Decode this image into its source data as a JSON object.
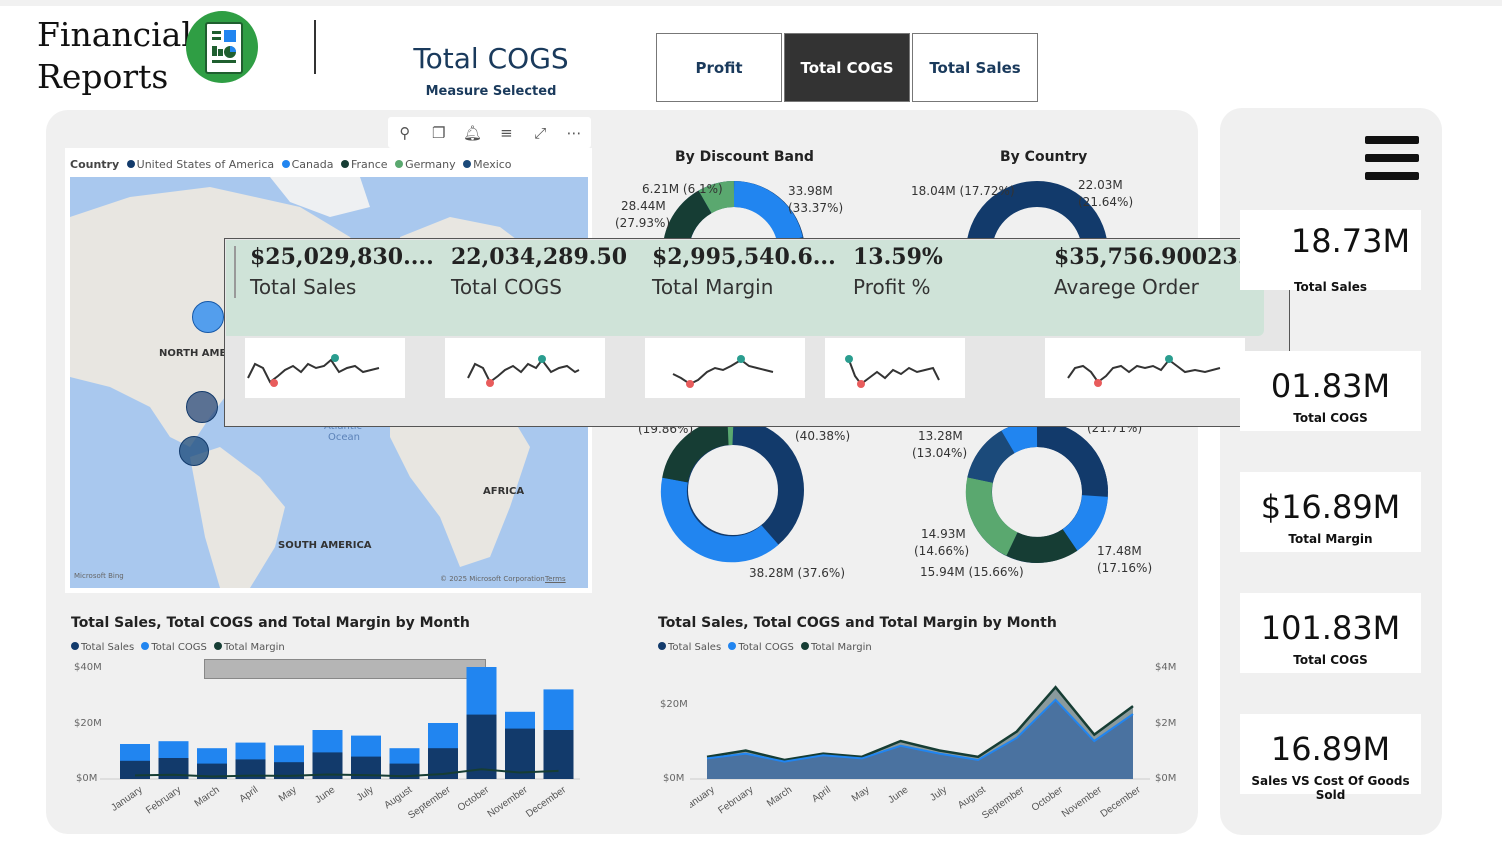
{
  "header": {
    "logo_line1": "Financial",
    "logo_line2": "Reports",
    "measure_title": "Total COGS",
    "measure_sub": "Measure Selected",
    "buttons": [
      {
        "label": "Profit",
        "active": false
      },
      {
        "label": "Total COGS",
        "active": true
      },
      {
        "label": "Total Sales",
        "active": false
      }
    ]
  },
  "map": {
    "legend_title": "Country",
    "legend": [
      {
        "name": "United States of America",
        "color": "#123a6b"
      },
      {
        "name": "Canada",
        "color": "#2185f0"
      },
      {
        "name": "France",
        "color": "#163d34"
      },
      {
        "name": "Germany",
        "color": "#5aa86f"
      },
      {
        "name": "Mexico",
        "color": "#1b4a7a"
      }
    ],
    "labels": {
      "north_america": "NORTH AMER",
      "atlantic": "Atlantic",
      "ocean": "Ocean",
      "africa": "AFRICA",
      "south_america": "SOUTH AMERICA",
      "bing": "Microsoft Bing",
      "copyright": "© 2025 Microsoft Corporation",
      "terms": "Terms"
    }
  },
  "donut_discount": {
    "title": "By Discount Band",
    "labels": {
      "a": "6.21M (6.1%)",
      "b": "28.44M",
      "b2": "(27.93%)",
      "c": "33.98M",
      "c2": "(33.37%)",
      "d": "(19.86%)",
      "e": "(40.38%)",
      "f": "38.28M (37.6%)"
    }
  },
  "donut_country": {
    "title": "By Country",
    "labels": {
      "a": "18.04M (17.72%)",
      "b": "22.03M",
      "b2": "(21.64%)",
      "c": "(21.71%)",
      "d": "13.28M",
      "d2": "(13.04%)",
      "e": "14.93M",
      "e2": "(14.66%)",
      "f": "15.94M (15.66%)",
      "g": "17.48M",
      "g2": "(17.16%)"
    }
  },
  "tooltip": {
    "cards": [
      {
        "value": "$25,029,830....",
        "label": "Total Sales"
      },
      {
        "value": "22,034,289.50",
        "label": "Total COGS"
      },
      {
        "value": "$2,995,540.6...",
        "label": "Total Margin"
      },
      {
        "value": "13.59%",
        "label": "Profit %"
      },
      {
        "value": "$35,756.90023...",
        "label": "Avarege Order"
      }
    ]
  },
  "kpis": [
    {
      "value": "18.73M",
      "label": "Total Sales"
    },
    {
      "value": "01.83M",
      "label": "Total COGS"
    },
    {
      "value": "$16.89M",
      "label": "Total Margin"
    },
    {
      "value": "101.83M",
      "label": "Total COGS"
    },
    {
      "value": "16.89M",
      "label": "Sales VS Cost Of Goods Sold"
    }
  ],
  "colors": {
    "sales": "#2185f0",
    "cogs": "#123a6b",
    "margin": "#163d34",
    "accent": "#5aa86f"
  },
  "chart_data": [
    {
      "type": "bar",
      "title": "Total Sales, Total COGS and Total Margin by Month",
      "legend": [
        "Total Sales",
        "Total COGS",
        "Total Margin"
      ],
      "categories": [
        "January",
        "February",
        "March",
        "April",
        "May",
        "June",
        "July",
        "August",
        "September",
        "October",
        "November",
        "December"
      ],
      "series": [
        {
          "name": "Total COGS",
          "values": [
            6.5,
            7.5,
            5.5,
            7,
            6,
            9.5,
            8,
            5.5,
            11,
            23,
            18,
            17.5
          ]
        },
        {
          "name": "Total Sales",
          "values": [
            12.5,
            13.5,
            11,
            13,
            12,
            17.5,
            15.5,
            11,
            20,
            40,
            24,
            32
          ]
        },
        {
          "name": "Total Margin",
          "values": [
            1.3,
            1.5,
            0.9,
            1.2,
            1.1,
            1.6,
            1.4,
            1.0,
            1.8,
            3.5,
            2.3,
            2.9
          ]
        }
      ],
      "yticks": [
        "$40M",
        "$20M",
        "$0M"
      ],
      "ylim": [
        0,
        40
      ]
    },
    {
      "type": "area",
      "title": "Total Sales, Total COGS and Total Margin by Month",
      "legend": [
        "Total Sales",
        "Total COGS",
        "Total Margin"
      ],
      "categories": [
        "January",
        "February",
        "March",
        "April",
        "May",
        "June",
        "July",
        "August",
        "September",
        "October",
        "November",
        "December"
      ],
      "series": [
        {
          "name": "Total Sales",
          "values": [
            7,
            9,
            6,
            8,
            7,
            12,
            9,
            7,
            15,
            29,
            14,
            23
          ]
        },
        {
          "name": "Total COGS",
          "values": [
            6.5,
            8,
            5.5,
            7.5,
            6.5,
            10.5,
            8,
            6,
            13,
            25,
            12,
            20.5
          ]
        },
        {
          "name": "Total Margin",
          "values": [
            0.6,
            0.9,
            0.5,
            0.7,
            0.6,
            1.2,
            0.9,
            0.6,
            1.5,
            3.2,
            1.5,
            2.6
          ]
        }
      ],
      "yticks_left": [
        "$20M",
        "$0M"
      ],
      "yticks_right": [
        "$4M",
        "$2M",
        "$0M"
      ]
    }
  ]
}
